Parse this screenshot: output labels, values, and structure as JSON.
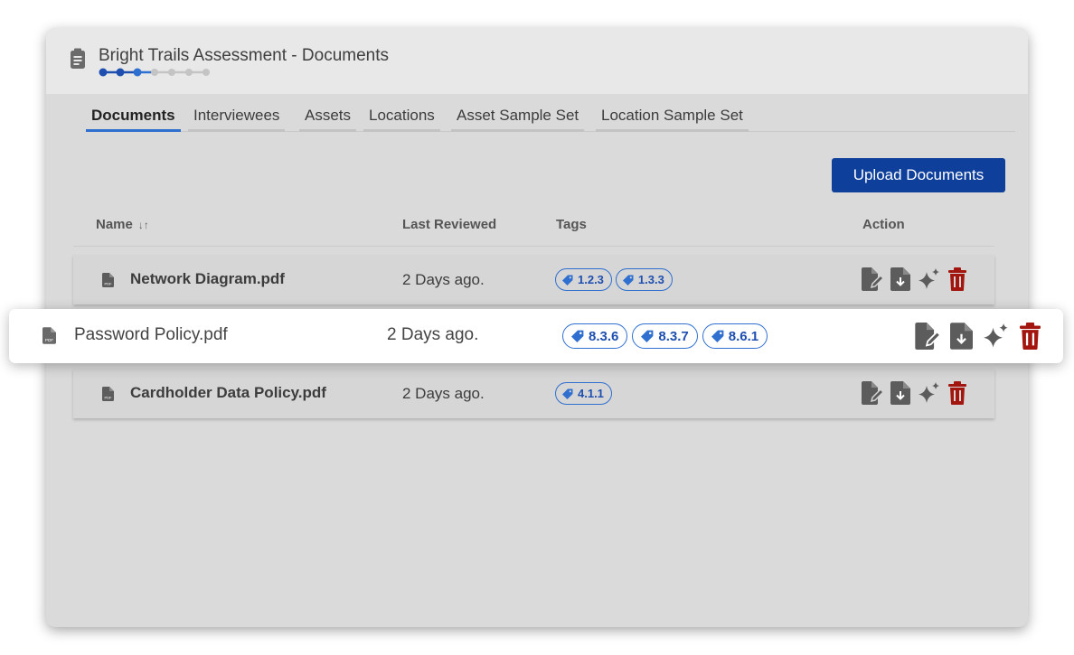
{
  "panel": {
    "title": "Bright Trails Assessment - Documents",
    "progress": {
      "total_steps": 7,
      "completed_steps": 3
    }
  },
  "tabs": [
    {
      "label": "Documents",
      "active": true
    },
    {
      "label": "Interviewees",
      "active": false
    },
    {
      "label": "Assets",
      "active": false
    },
    {
      "label": "Locations",
      "active": false
    },
    {
      "label": "Asset Sample Set",
      "active": false
    },
    {
      "label": "Location Sample Set",
      "active": false
    }
  ],
  "upload_button": {
    "label": "Upload Documents"
  },
  "table": {
    "headers": {
      "name": "Name",
      "sort_icon": "↓↑",
      "last_reviewed": "Last Reviewed",
      "tags": "Tags",
      "action": "Action"
    },
    "rows": [
      {
        "name": "Network Diagram.pdf",
        "last_reviewed": "2 Days ago.",
        "tags": [
          "1.2.3",
          "1.3.3"
        ]
      },
      {
        "name": "Password Policy.pdf",
        "last_reviewed": "2 Days ago.",
        "tags": [
          "8.3.6",
          "8.3.7",
          "8.6.1"
        ],
        "dragging": true
      },
      {
        "name": "Cardholder Data Policy.pdf",
        "last_reviewed": "2 Days ago.",
        "tags": [
          "4.1.1"
        ]
      }
    ],
    "action_icons": [
      "sign-document-icon",
      "download-document-icon",
      "ai-sparkle-icon",
      "delete-trash-icon"
    ]
  },
  "colors": {
    "accent": "#2f6fd0",
    "button_bg": "#0d3f9b",
    "delete": "#a3160f",
    "icon_gray": "#5c5c5c",
    "progress_done": "#1e4fb0",
    "progress_pending": "#c4c4c4"
  }
}
